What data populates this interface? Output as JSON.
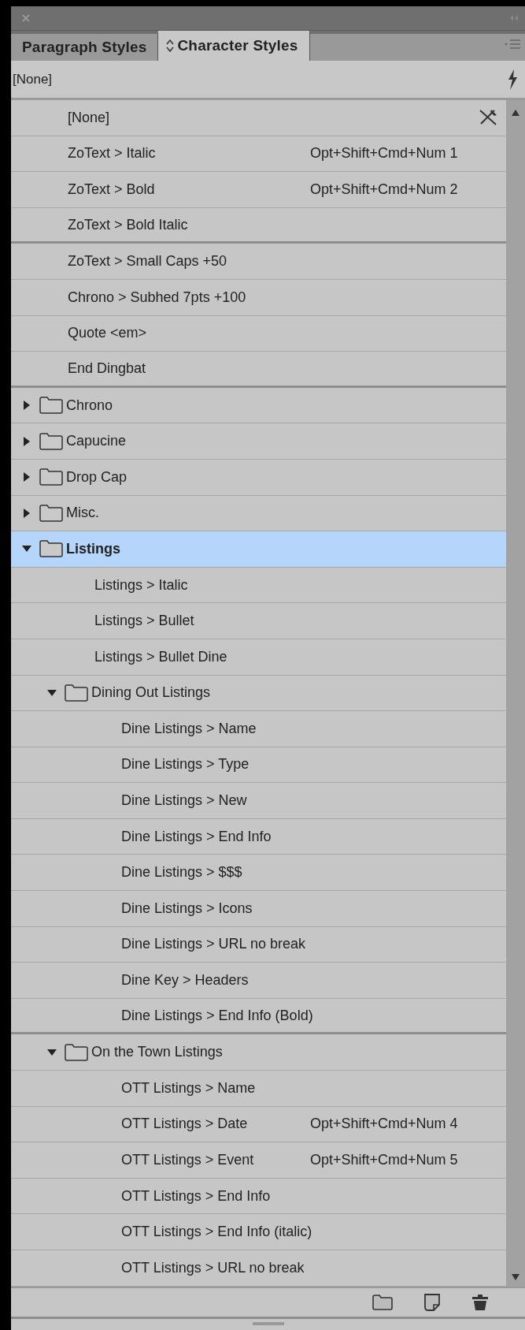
{
  "tabs": [
    {
      "label": "Paragraph Styles",
      "selected": false
    },
    {
      "label": "Character Styles",
      "selected": true
    }
  ],
  "current_style": "[None]",
  "styles": [
    {
      "kind": "style",
      "name": "[None]",
      "selected": false,
      "separator_after": false
    },
    {
      "kind": "style",
      "name": "ZoText > Italic",
      "shortcut": "Opt+Shift+Cmd+Num 1",
      "selected": false,
      "separator_after": false
    },
    {
      "kind": "style",
      "name": "ZoText > Bold",
      "shortcut": "Opt+Shift+Cmd+Num 2",
      "selected": false,
      "separator_after": false
    },
    {
      "kind": "style",
      "name": "ZoText > Bold Italic",
      "selected": false,
      "separator_after": true
    },
    {
      "kind": "style",
      "name": "ZoText > Small Caps +50",
      "selected": false,
      "separator_after": false
    },
    {
      "kind": "style",
      "name": "Chrono > Subhed 7pts +100",
      "selected": false,
      "separator_after": false
    },
    {
      "kind": "style",
      "name": "Quote <em>",
      "selected": false,
      "separator_after": false
    },
    {
      "kind": "style",
      "name": "End Dingbat",
      "selected": false,
      "separator_after": true
    },
    {
      "kind": "group",
      "name": "Chrono",
      "expanded": false,
      "selected": false,
      "separator_after": false
    },
    {
      "kind": "group",
      "name": "Capucine",
      "expanded": false,
      "selected": false,
      "separator_after": false
    },
    {
      "kind": "group",
      "name": "Drop Cap",
      "expanded": false,
      "selected": false,
      "separator_after": false
    },
    {
      "kind": "group",
      "name": "Misc.",
      "expanded": false,
      "selected": false,
      "separator_after": false
    },
    {
      "kind": "group",
      "name": "Listings",
      "expanded": true,
      "selected": true,
      "separator_after": false,
      "children": [
        {
          "kind": "style",
          "name": "Listings > Italic",
          "selected": false,
          "separator_after": false
        },
        {
          "kind": "style",
          "name": "Listings > Bullet",
          "selected": false,
          "separator_after": false
        },
        {
          "kind": "style",
          "name": "Listings > Bullet Dine",
          "selected": false,
          "separator_after": false
        },
        {
          "kind": "group",
          "name": "Dining Out Listings",
          "expanded": true,
          "selected": false,
          "separator_after": false,
          "children": [
            {
              "kind": "style",
              "name": "Dine Listings > Name",
              "selected": false,
              "separator_after": false
            },
            {
              "kind": "style",
              "name": "Dine Listings > Type",
              "selected": false,
              "separator_after": false
            },
            {
              "kind": "style",
              "name": "Dine Listings > New",
              "selected": false,
              "separator_after": false
            },
            {
              "kind": "style",
              "name": "Dine Listings > End Info",
              "selected": false,
              "separator_after": false
            },
            {
              "kind": "style",
              "name": "Dine Listings > $$$",
              "selected": false,
              "separator_after": false
            },
            {
              "kind": "style",
              "name": "Dine Listings > Icons",
              "selected": false,
              "separator_after": false
            },
            {
              "kind": "style",
              "name": "Dine Listings > URL no break",
              "selected": false,
              "separator_after": false
            },
            {
              "kind": "style",
              "name": "Dine Key > Headers",
              "selected": false,
              "separator_after": false
            },
            {
              "kind": "style",
              "name": "Dine Listings > End Info (Bold)",
              "selected": false,
              "separator_after": true
            }
          ]
        },
        {
          "kind": "group",
          "name": "On the Town Listings",
          "expanded": true,
          "selected": false,
          "separator_after": false,
          "children": [
            {
              "kind": "style",
              "name": "OTT Listings > Name",
              "selected": false,
              "separator_after": false
            },
            {
              "kind": "style",
              "name": "OTT Listings > Date",
              "shortcut": "Opt+Shift+Cmd+Num 4",
              "selected": false,
              "separator_after": false
            },
            {
              "kind": "style",
              "name": "OTT Listings > Event",
              "shortcut": "Opt+Shift+Cmd+Num 5",
              "selected": false,
              "separator_after": false
            },
            {
              "kind": "style",
              "name": "OTT Listings > End Info",
              "selected": false,
              "separator_after": false
            },
            {
              "kind": "style",
              "name": "OTT Listings > End Info (italic)",
              "selected": false,
              "separator_after": false
            },
            {
              "kind": "style",
              "name": "OTT Listings > URL no break",
              "selected": false,
              "separator_after": false
            }
          ]
        }
      ]
    }
  ]
}
